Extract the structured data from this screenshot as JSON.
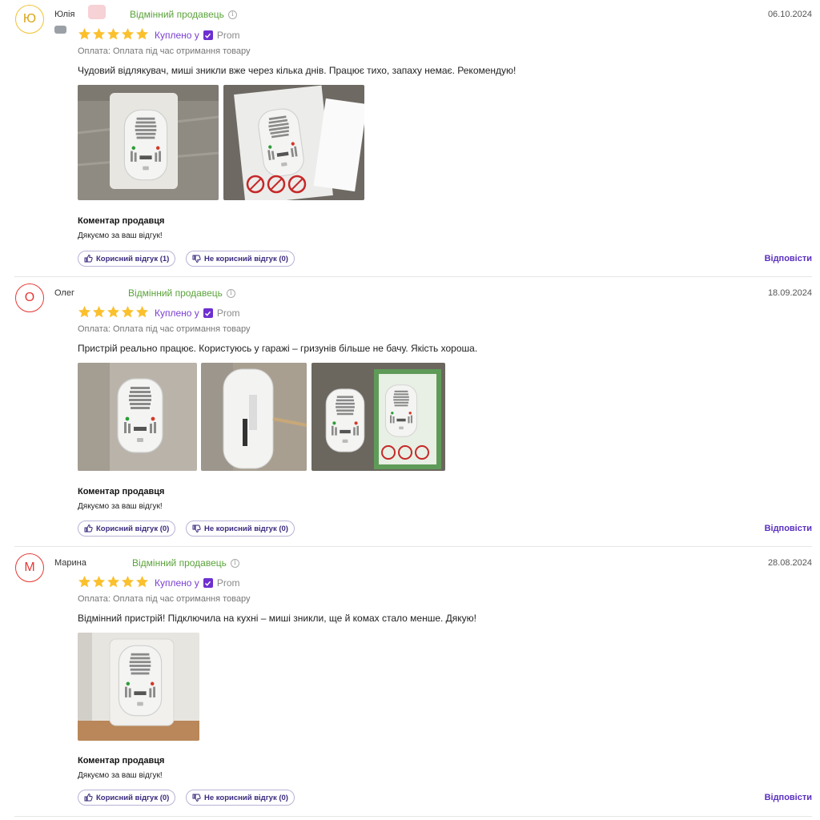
{
  "colors": {
    "avatar_yellow": "#f2c233",
    "avatar_red": "#e53935",
    "seller_green": "#5aa33a",
    "bought_purple": "#7a3fd0",
    "star_yellow": "#fbc02d",
    "link_purple": "#5a2fc0"
  },
  "icons": {
    "star": "star-icon",
    "info": "info-icon",
    "check": "check-icon",
    "like": "thumbs-up-icon",
    "dislike": "thumbs-down-icon"
  },
  "reviews": [
    {
      "avatar_letter": "Ю",
      "author": "Юлія",
      "seller_badge": "Відмінний продавець",
      "date": "06.10.2024",
      "rating": 5,
      "bought_label": "Куплено у",
      "bought_store": "Prom",
      "payment": "Оплата: Оплата під час отримання товару",
      "text": "Чудовий відлякувач, миші зникли вже через кілька днів. Працює тихо, запаху немає. Рекомендую!",
      "seller_comment_title": "Коментар продавця",
      "seller_comment": "Дякуємо за ваш відгук!",
      "helpful": "Корисний відгук (1)",
      "not_helpful": "Не корисний відгук (0)",
      "reply": "Відповісти"
    },
    {
      "avatar_letter": "О",
      "author": "Олег",
      "seller_badge": "Відмінний продавець",
      "date": "18.09.2024",
      "rating": 5,
      "bought_label": "Куплено у",
      "bought_store": "Prom",
      "payment": "Оплата: Оплата під час отримання товару",
      "text": "Пристрій реально працює. Користуюсь у гаражі – гризунів більше не бачу. Якість хороша.",
      "seller_comment_title": "Коментар продавця",
      "seller_comment": "Дякуємо за ваш відгук!",
      "helpful": "Корисний відгук (0)",
      "not_helpful": "Не корисний відгук (0)",
      "reply": "Відповісти"
    },
    {
      "avatar_letter": "М",
      "author": "Марина",
      "seller_badge": "Відмінний продавець",
      "date": "28.08.2024",
      "rating": 5,
      "bought_label": "Куплено у",
      "bought_store": "Prom",
      "payment": "Оплата: Оплата під час отримання товару",
      "text": "Відмінний пристрій! Підключила на кухні – миші зникли, ще й комах стало менше. Дякую!",
      "seller_comment_title": "Коментар продавця",
      "seller_comment": "Дякуємо за ваш відгук!",
      "helpful": "Корисний відгук (0)",
      "not_helpful": "Не корисний відгук (0)",
      "reply": "Відповісти"
    }
  ]
}
